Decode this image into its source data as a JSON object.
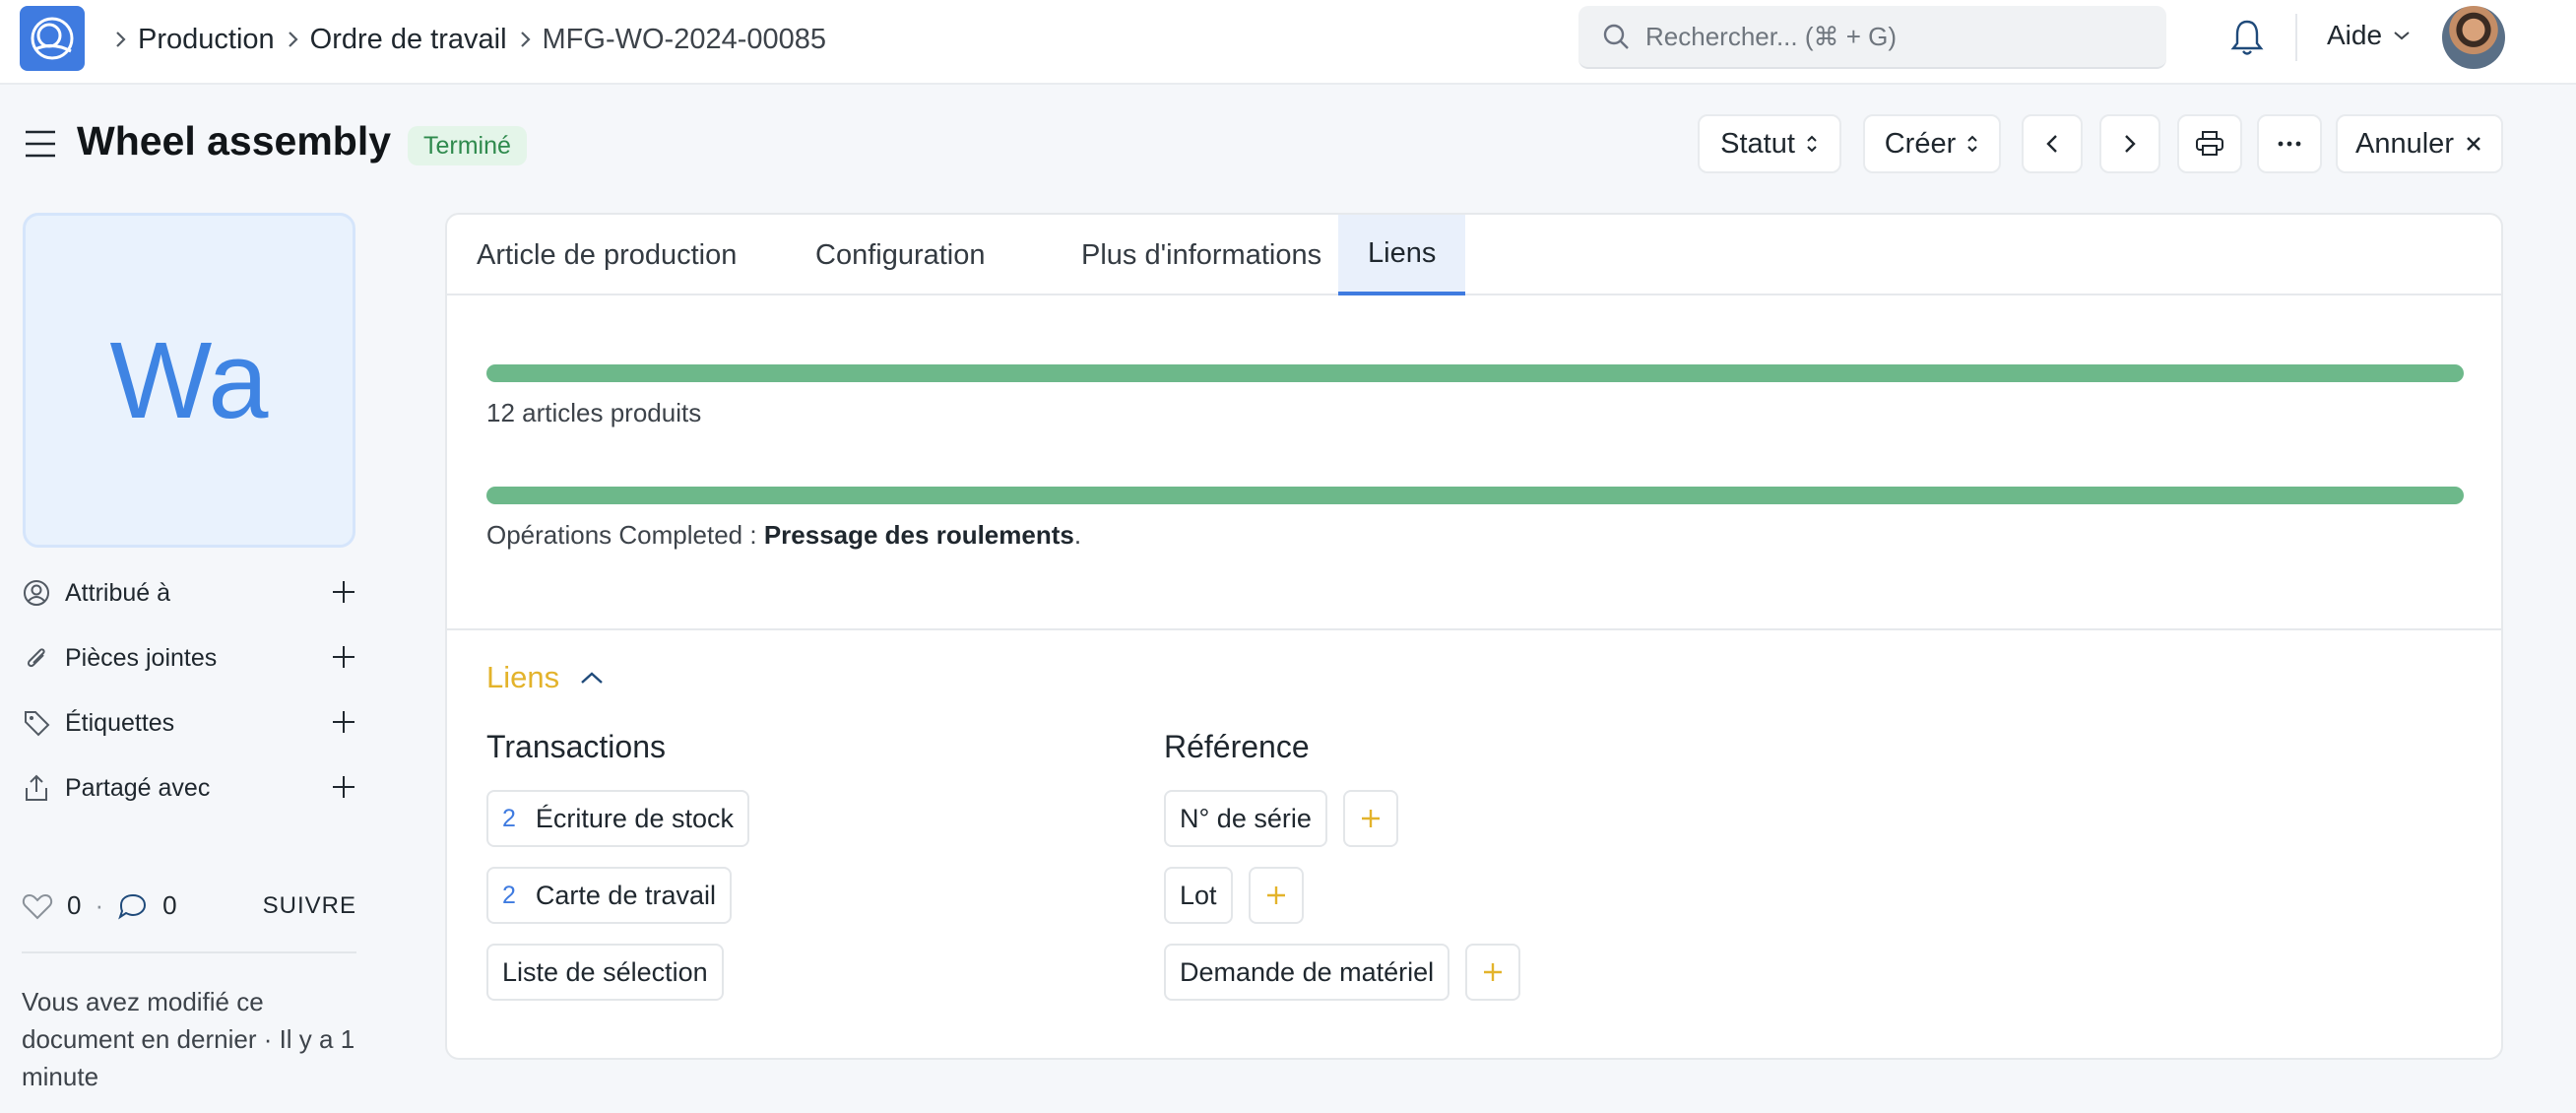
{
  "breadcrumb": [
    "Production",
    "Ordre de travail",
    "MFG-WO-2024-00085"
  ],
  "search": {
    "placeholder": "Rechercher... (⌘ + G)"
  },
  "header": {
    "help_label": "Aide"
  },
  "page": {
    "title": "Wheel assembly",
    "status": "Terminé",
    "buttons": {
      "status": "Statut",
      "create": "Créer",
      "cancel": "Annuler"
    }
  },
  "sidebar": {
    "avatar_initials": "Wa",
    "items": [
      {
        "label": "Attribué à",
        "icon": "user-icon"
      },
      {
        "label": "Pièces jointes",
        "icon": "paperclip-icon"
      },
      {
        "label": "Étiquettes",
        "icon": "tag-icon"
      },
      {
        "label": "Partagé avec",
        "icon": "share-icon"
      }
    ],
    "likes": "0",
    "comments": "0",
    "follow_label": "SUIVRE",
    "note": "Vous avez modifié ce document en dernier · Il y a 1 minute"
  },
  "tabs": [
    "Article de production",
    "Configuration",
    "Plus d'informations",
    "Liens"
  ],
  "active_tab": "Liens",
  "progress": [
    {
      "value": 1.0,
      "label": "12 articles produits"
    },
    {
      "value": 1.0,
      "label_prefix": "Opérations Completed : ",
      "label_bold": "Pressage des roulements",
      "label_suffix": "."
    }
  ],
  "links": {
    "section_title": "Liens",
    "transactions_title": "Transactions",
    "reference_title": "Référence",
    "transactions": [
      {
        "count": "2",
        "label": "Écriture de stock"
      },
      {
        "count": "2",
        "label": "Carte de travail"
      },
      {
        "count": "",
        "label": "Liste de sélection"
      }
    ],
    "references": [
      {
        "label": "N° de série"
      },
      {
        "label": "Lot"
      },
      {
        "label": "Demande de matériel"
      }
    ]
  },
  "colors": {
    "accent": "#3f7be0",
    "success": "#6db88a",
    "section": "#e3b32b"
  }
}
